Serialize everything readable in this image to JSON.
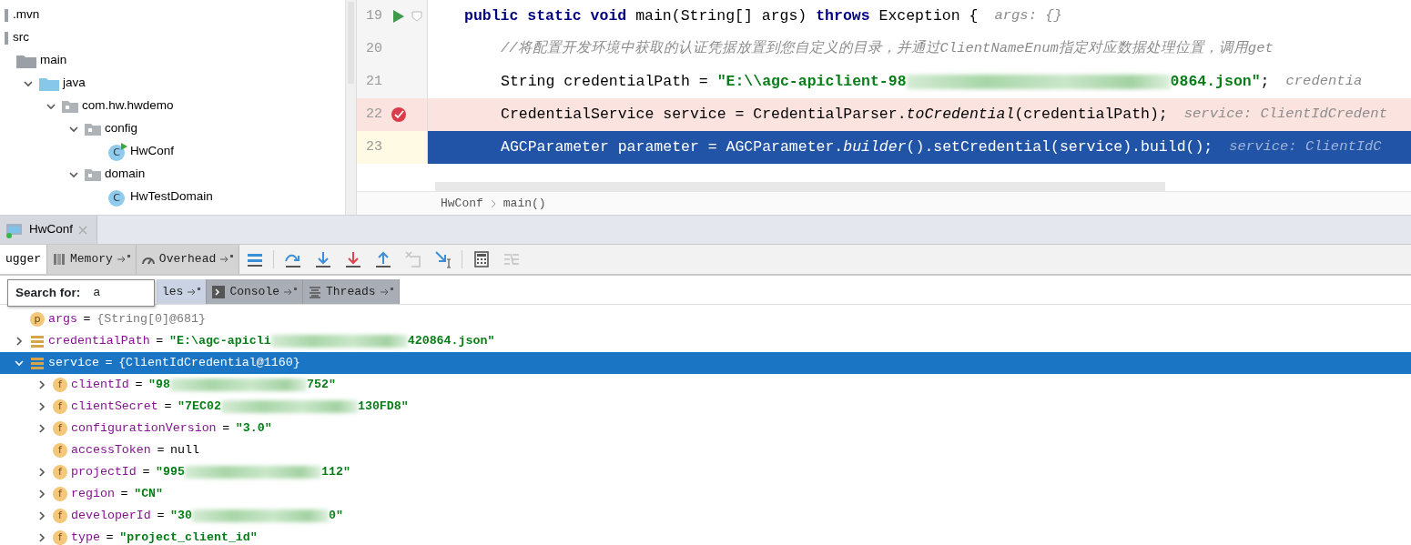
{
  "project_tree": [
    {
      "label": ".mvn",
      "kind": "module"
    },
    {
      "label": "src",
      "kind": "module",
      "children": [
        {
          "label": "main",
          "kind": "folder",
          "children": [
            {
              "label": "java",
              "kind": "source",
              "expanded": true,
              "children": [
                {
                  "label": "com.hw.hwdemo",
                  "kind": "package",
                  "expanded": true,
                  "children": [
                    {
                      "label": "config",
                      "kind": "package",
                      "expanded": true,
                      "children": [
                        {
                          "label": "HwConf",
                          "kind": "runnable",
                          "badge": "C"
                        }
                      ]
                    },
                    {
                      "label": "domain",
                      "kind": "package",
                      "expanded": true,
                      "children": [
                        {
                          "label": "HwTestDomain",
                          "kind": "class",
                          "badge": "C"
                        }
                      ]
                    }
                  ]
                }
              ]
            }
          ]
        }
      ]
    }
  ],
  "editor": {
    "lines": [
      {
        "number": "19",
        "kind": "declaration",
        "run": true,
        "fold": true,
        "breakpoint": false,
        "current": false,
        "tokens": [
          {
            "kind": "kw",
            "text": "public static void"
          },
          {
            "kind": "plain",
            "text": " main(String[] args) "
          },
          {
            "kind": "kw",
            "text": "throws"
          },
          {
            "kind": "plain",
            "text": " Exception {"
          },
          {
            "kind": "hint",
            "text": "args: {}"
          }
        ]
      },
      {
        "number": "20",
        "kind": "statement",
        "run": false,
        "fold": false,
        "breakpoint": false,
        "current": false,
        "tokens": [
          {
            "kind": "comment",
            "text": "//将配置开发环境中获取的认证凭据放置到您自定义的目录，并通过ClientNameEnum指定对应数据处理位置，调用get"
          }
        ]
      },
      {
        "number": "21",
        "kind": "statement",
        "run": false,
        "fold": false,
        "breakpoint": false,
        "current": false,
        "tokens": [
          {
            "kind": "plain",
            "text": "String credentialPath = "
          },
          {
            "kind": "str",
            "text": "\"E:\\\\agc-apiclient-98"
          },
          {
            "kind": "redacted"
          },
          {
            "kind": "str",
            "text": "0864.json\""
          },
          {
            "kind": "plain",
            "text": ";"
          },
          {
            "kind": "hint",
            "text": "credentia"
          }
        ]
      },
      {
        "number": "22",
        "kind": "statement",
        "run": false,
        "fold": false,
        "breakpoint": true,
        "current": false,
        "tokens": [
          {
            "kind": "plain",
            "text": "CredentialService service = CredentialParser."
          },
          {
            "kind": "ital",
            "text": "toCredential"
          },
          {
            "kind": "plain",
            "text": "(credentialPath);"
          },
          {
            "kind": "hint",
            "text": "service: ClientIdCredent"
          }
        ]
      },
      {
        "number": "23",
        "kind": "statement",
        "run": false,
        "fold": false,
        "breakpoint": false,
        "current": true,
        "tokens": [
          {
            "kind": "plain",
            "text": "AGCParameter parameter = AGCParameter."
          },
          {
            "kind": "ital",
            "text": "builder"
          },
          {
            "kind": "plain",
            "text": "().setCredential(service).build();"
          },
          {
            "kind": "hint",
            "text": "service: ClientIdC"
          }
        ]
      }
    ],
    "breadcrumbs": [
      "HwConf",
      "main()"
    ]
  },
  "debug": {
    "session_tab": {
      "label": "HwConf"
    },
    "view_tabs": [
      {
        "label": "ugger",
        "kind": "debugger",
        "selected": true
      },
      {
        "label": "Memory",
        "kind": "memory",
        "selected": false
      },
      {
        "label": "Overhead",
        "kind": "overhead",
        "selected": false
      }
    ],
    "toolbar": [
      {
        "kind": "layout",
        "disabled": false
      },
      {
        "kind": "step-over",
        "disabled": false
      },
      {
        "kind": "step-into",
        "disabled": false
      },
      {
        "kind": "force-step-into",
        "disabled": false
      },
      {
        "kind": "step-out",
        "disabled": false
      },
      {
        "kind": "drop-frame",
        "disabled": true
      },
      {
        "kind": "run-to-cursor",
        "disabled": false
      },
      {
        "kind": "evaluate",
        "disabled": false
      },
      {
        "kind": "trace",
        "disabled": true
      }
    ],
    "sub_tabs": [
      {
        "label": "les",
        "kind": "variables",
        "selected": true
      },
      {
        "label": "Console",
        "kind": "console",
        "selected": false
      },
      {
        "label": "Threads",
        "kind": "threads",
        "selected": false
      }
    ],
    "search_popup": {
      "label": "Search for:",
      "value": "a"
    },
    "variables": [
      {
        "badge": "p",
        "name": "args",
        "value": [
          {
            "kind": "plain",
            "text": "="
          },
          {
            "kind": "obj",
            "text": "{String[0]@681}"
          }
        ],
        "selected": false
      },
      {
        "kind": "local",
        "name": "credentialPath",
        "expanded": false,
        "value": [
          {
            "kind": "plain",
            "text": "="
          },
          {
            "kind": "str",
            "text": "\"E:\\agc-apicli"
          },
          {
            "kind": "redacted"
          },
          {
            "kind": "str",
            "text": "420864.json\""
          }
        ],
        "selected": false
      },
      {
        "kind": "local",
        "name": "service",
        "expanded": true,
        "value": [
          {
            "kind": "plain",
            "text": "="
          },
          {
            "kind": "obj",
            "text": "{ClientIdCredential@1160}"
          }
        ],
        "selected": true,
        "children": [
          {
            "badge": "f",
            "name": "clientId",
            "expanded": false,
            "value": [
              {
                "kind": "plain",
                "text": "="
              },
              {
                "kind": "str",
                "text": "\"98"
              },
              {
                "kind": "redacted"
              },
              {
                "kind": "str",
                "text": "752\""
              }
            ],
            "selected": false
          },
          {
            "badge": "f",
            "name": "clientSecret",
            "expanded": false,
            "value": [
              {
                "kind": "plain",
                "text": "="
              },
              {
                "kind": "str",
                "text": "\"7EC02"
              },
              {
                "kind": "redacted"
              },
              {
                "kind": "str",
                "text": "130FD8\""
              }
            ],
            "selected": false
          },
          {
            "badge": "f",
            "name": "configurationVersion",
            "expanded": false,
            "value": [
              {
                "kind": "plain",
                "text": "="
              },
              {
                "kind": "str",
                "text": "\"3.0\""
              }
            ],
            "selected": false
          },
          {
            "badge": "f",
            "name": "accessToken",
            "value": [
              {
                "kind": "plain",
                "text": "="
              },
              {
                "kind": "plain",
                "text": "null"
              }
            ],
            "selected": false
          },
          {
            "badge": "f",
            "name": "projectId",
            "expanded": false,
            "value": [
              {
                "kind": "plain",
                "text": "="
              },
              {
                "kind": "str",
                "text": "\"995"
              },
              {
                "kind": "redacted"
              },
              {
                "kind": "str",
                "text": "112\""
              }
            ],
            "selected": false
          },
          {
            "badge": "f",
            "name": "region",
            "expanded": false,
            "value": [
              {
                "kind": "plain",
                "text": "="
              },
              {
                "kind": "str",
                "text": "\"CN\""
              }
            ],
            "selected": false
          },
          {
            "badge": "f",
            "name": "developerId",
            "expanded": false,
            "value": [
              {
                "kind": "plain",
                "text": "="
              },
              {
                "kind": "str",
                "text": "\"30"
              },
              {
                "kind": "redacted"
              },
              {
                "kind": "str",
                "text": "0\""
              }
            ],
            "selected": false
          },
          {
            "badge": "f",
            "name": "type",
            "expanded": false,
            "value": [
              {
                "kind": "plain",
                "text": "="
              },
              {
                "kind": "str",
                "text": "\"project_client_id\""
              }
            ],
            "selected": false
          }
        ]
      }
    ]
  }
}
